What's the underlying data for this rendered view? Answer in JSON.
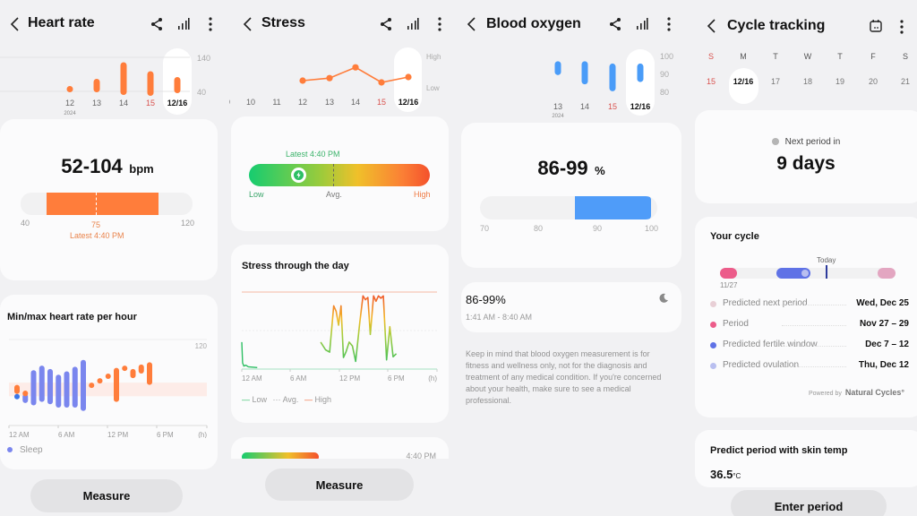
{
  "heart_rate": {
    "title": "Heart rate",
    "week": {
      "days": [
        "12",
        "13",
        "14",
        "15",
        "12/16"
      ],
      "year": "2024",
      "highlight_day": "15",
      "selected": "12/16",
      "ymax_label": "140",
      "ymin_label": "40",
      "ranges": [
        [
          60,
          72
        ],
        [
          58,
          88
        ],
        [
          52,
          125
        ],
        [
          50,
          105
        ],
        [
          56,
          92
        ]
      ],
      "ylim": [
        40,
        140
      ]
    },
    "summary": {
      "value": "52-104",
      "unit": "bpm",
      "range": [
        52,
        104
      ],
      "scale_min": "40",
      "scale_max": "120",
      "avg": "75",
      "latest": "Latest 4:40 PM"
    },
    "hourly": {
      "title": "Min/max heart rate per hour",
      "ymax_label": "120",
      "x_labels": [
        "12 AM",
        "6 AM",
        "12 PM",
        "6 PM",
        "(h)"
      ],
      "legend_sleep": "Sleep",
      "bars": [
        {
          "h": 0,
          "min": 72,
          "max": 80,
          "type": "awake"
        },
        {
          "h": 0,
          "min": 70,
          "max": 72,
          "type": "dot"
        },
        {
          "h": 1,
          "min": 64,
          "max": 72,
          "type": "sleep"
        },
        {
          "h": 1,
          "min": 70,
          "max": 75,
          "type": "awake"
        },
        {
          "h": 2,
          "min": 62,
          "max": 93,
          "type": "sleep"
        },
        {
          "h": 3,
          "min": 65,
          "max": 97,
          "type": "sleep"
        },
        {
          "h": 4,
          "min": 63,
          "max": 94,
          "type": "sleep"
        },
        {
          "h": 5,
          "min": 60,
          "max": 89,
          "type": "sleep"
        },
        {
          "h": 6,
          "min": 60,
          "max": 92,
          "type": "sleep"
        },
        {
          "h": 7,
          "min": 60,
          "max": 96,
          "type": "sleep"
        },
        {
          "h": 8,
          "min": 57,
          "max": 102,
          "type": "sleep"
        },
        {
          "h": 9,
          "min": 80,
          "max": 82,
          "type": "awake"
        },
        {
          "h": 10,
          "min": 85,
          "max": 86,
          "type": "awake"
        },
        {
          "h": 11,
          "min": 88,
          "max": 90,
          "type": "awake"
        },
        {
          "h": 12,
          "min": 65,
          "max": 95,
          "type": "awake"
        },
        {
          "h": 13,
          "min": 93,
          "max": 97,
          "type": "awake"
        },
        {
          "h": 14,
          "min": 86,
          "max": 94,
          "type": "awake"
        },
        {
          "h": 15,
          "min": 90,
          "max": 98,
          "type": "awake"
        },
        {
          "h": 16,
          "min": 80,
          "max": 100,
          "type": "awake"
        }
      ],
      "band": [
        70,
        82
      ],
      "ylim": [
        45,
        120
      ]
    },
    "measure_label": "Measure"
  },
  "stress": {
    "title": "Stress",
    "week": {
      "days": [
        "10",
        "11",
        "12",
        "13",
        "14",
        "15",
        "12/16"
      ],
      "highlight_day": "15",
      "selected": "12/16",
      "high_label": "High",
      "low_label": "Low",
      "values": [
        null,
        null,
        0.45,
        0.52,
        0.82,
        0.4,
        0.55
      ]
    },
    "latest": {
      "label": "Latest 4:40 PM",
      "position": 0.27,
      "low": "Low",
      "avg": "Avg.",
      "high": "High"
    },
    "day": {
      "title": "Stress through the day",
      "x_labels": [
        "12 AM",
        "6 AM",
        "12 PM",
        "6 PM",
        "(h)"
      ],
      "legend": [
        "Low",
        "Avg.",
        "High"
      ],
      "series_a": [
        [
          0.0,
          0.35
        ],
        [
          0.1,
          0.08
        ],
        [
          0.25,
          0.04
        ],
        [
          0.5,
          0.05
        ],
        [
          0.8,
          0.03
        ],
        [
          1.9,
          0.02
        ]
      ],
      "series_b": [
        [
          9.7,
          0.35
        ],
        [
          10.3,
          0.25
        ],
        [
          10.8,
          0.22
        ],
        [
          11.3,
          0.82
        ],
        [
          11.6,
          0.75
        ],
        [
          11.9,
          0.57
        ],
        [
          12.2,
          0.82
        ],
        [
          12.5,
          0.15
        ],
        [
          12.8,
          0.22
        ],
        [
          13.2,
          0.35
        ],
        [
          13.6,
          0.3
        ],
        [
          14.0,
          0.1
        ],
        [
          14.5,
          0.6
        ],
        [
          14.9,
          0.95
        ],
        [
          15.2,
          0.9
        ],
        [
          15.5,
          0.93
        ],
        [
          15.8,
          0.45
        ],
        [
          16.2,
          0.95
        ],
        [
          16.5,
          0.88
        ],
        [
          16.8,
          0.95
        ],
        [
          17.1,
          0.92
        ],
        [
          17.4,
          0.95
        ],
        [
          17.8,
          0.12
        ],
        [
          18.2,
          0.55
        ],
        [
          18.6,
          0.16
        ],
        [
          19.0,
          0.2
        ]
      ],
      "ylim": [
        0,
        1
      ]
    },
    "peek_time": "4:40 PM",
    "measure_label": "Measure"
  },
  "blood_oxygen": {
    "title": "Blood oxygen",
    "week": {
      "days": [
        "13",
        "14",
        "15",
        "12/16"
      ],
      "year": "2024",
      "highlight_day": "15",
      "selected": "12/16",
      "y_labels": [
        "100",
        "90",
        "80"
      ],
      "ranges": [
        [
          92,
          98
        ],
        [
          88,
          98
        ],
        [
          85,
          97
        ],
        [
          89,
          97
        ]
      ],
      "ylim": [
        78,
        102
      ]
    },
    "summary": {
      "value": "86-99",
      "unit": "%",
      "range": [
        86,
        99
      ],
      "ticks": [
        "70",
        "80",
        "90",
        "100"
      ],
      "scale": [
        70,
        100
      ]
    },
    "session": {
      "range": "86-99%",
      "time": "1:41 AM - 8:40 AM"
    },
    "disclaimer": "Keep in mind that blood oxygen measurement is for fitness and wellness only, not for the diagnosis and treatment of any medical condition. If you're concerned about your health, make sure to see a medical professional."
  },
  "cycle": {
    "title": "Cycle tracking",
    "weekdays": [
      "S",
      "M",
      "T",
      "W",
      "T",
      "F",
      "S"
    ],
    "dates": [
      "15",
      "12/16",
      "17",
      "18",
      "19",
      "20",
      "21"
    ],
    "selected": "12/16",
    "next_period_label": "Next period in",
    "next_period_value": "9 days",
    "your_cycle": {
      "title": "Your cycle",
      "today_label": "Today",
      "start_label": "11/27",
      "legend": [
        {
          "label": "Predicted next period",
          "value": "Wed, Dec 25",
          "color": "#e8cfd6"
        },
        {
          "label": "Period",
          "value": "Nov 27 – 29",
          "color": "#ec5c8a"
        },
        {
          "label": "Predicted fertile window",
          "value": "Dec 7 – 12",
          "color": "#5f72e6"
        },
        {
          "label": "Predicted ovulation",
          "value": "Thu, Dec 12",
          "color": "#b9bff0"
        }
      ],
      "powered_by": "Powered by",
      "brand": "Natural Cycles°"
    },
    "skin_temp_title": "Predict period with skin temp",
    "skin_temp_value": "36.5",
    "skin_temp_unit": "°C",
    "enter_label": "Enter period"
  },
  "colors": {
    "heart": "#ff7d3b",
    "oxygen": "#4a9cf8",
    "sleep": "#7a86ee",
    "low_green": "#28c76f",
    "high_red": "#f4512c"
  }
}
